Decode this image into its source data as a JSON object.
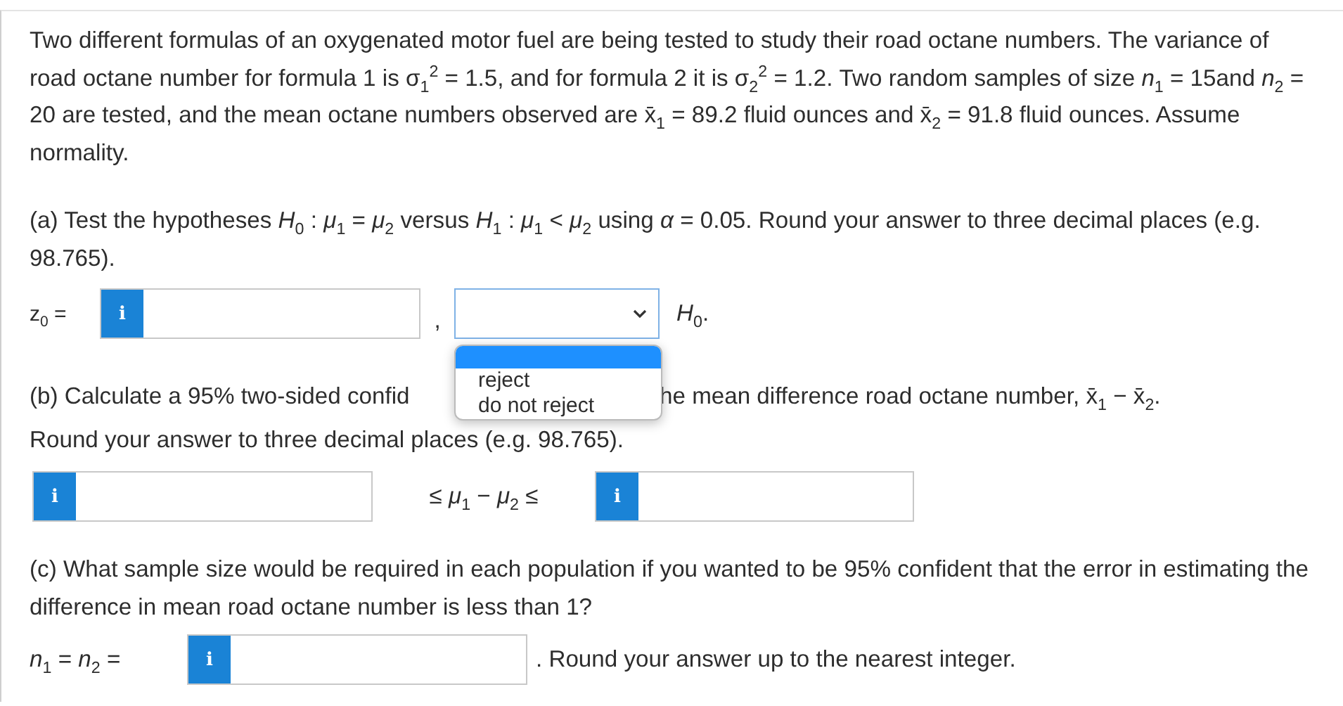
{
  "intro": "Two different formulas of an oxygenated motor fuel are being tested to study their road octane numbers. The variance of road octane number for formula 1 is σ$_{1}$$^{2}$ = 1.5, and for formula 2 it is σ$_{2}$$^{2}$ = 1.2. Two random samples of size *n*$_{1}$ = 15and *n*$_{2}$ = 20 are tested, and the mean octane numbers observed are x̄$_{1}$ = 89.2 fluid ounces and x̄$_{2}$ = 91.8 fluid ounces. Assume normality.",
  "part_a": {
    "question": "(a) Test the hypotheses *H*$_{0}$ : *μ*$_{1}$ = *μ*$_{2}$ versus *H*$_{1}$ : *μ*$_{1}$ < *μ*$_{2}$ using *α* = 0.05. Round your answer to three decimal places (e.g. 98.765).",
    "z_label": "z$_{0}$ =",
    "info": "i",
    "comma": ",",
    "decision": {
      "open": true,
      "options": [
        {
          "label": "reject",
          "selected": false
        },
        {
          "label": "do not reject",
          "selected": false
        }
      ]
    },
    "after": "*H*$_{0}$."
  },
  "part_b": {
    "question_start": "(b) Calculate a 95% two-sided confid",
    "question_end": "he mean difference road octane number, x̄$_{1}$ − x̄$_{2}$.",
    "question_line2": "Round your answer to three decimal places (e.g. 98.765).",
    "info_lower": "i",
    "between": "≤ *μ*$_{1}$ − *μ*$_{2}$ ≤",
    "info_upper": "i"
  },
  "part_c": {
    "question": "(c) What sample size would be required in each population if you wanted to be 95% confident that the error in estimating the difference in mean road octane number is less than 1?",
    "n_label": "*n*$_{1}$ = *n*$_{2}$ =",
    "info": "i",
    "after": ". Round your answer up to the nearest integer."
  }
}
